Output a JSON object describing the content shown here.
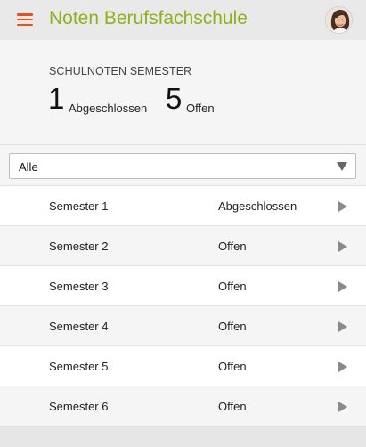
{
  "header": {
    "title": "Noten Berufsfachschule",
    "menu_icon": "hamburger-menu-icon",
    "avatar_icon": "user-avatar",
    "accent_color": "#8fb21a",
    "menu_color": "#e8501f"
  },
  "summary": {
    "title": "SCHULNOTEN SEMESTER",
    "closed_count": "1",
    "closed_label": "Abgeschlossen",
    "open_count": "5",
    "open_label": "Offen"
  },
  "filter": {
    "selected": "Alle",
    "arrow_icon": "caret-down-icon"
  },
  "semesters": [
    {
      "name": "Semester 1",
      "status": "Abgeschlossen"
    },
    {
      "name": "Semester 2",
      "status": "Offen"
    },
    {
      "name": "Semester 3",
      "status": "Offen"
    },
    {
      "name": "Semester 4",
      "status": "Offen"
    },
    {
      "name": "Semester 5",
      "status": "Offen"
    },
    {
      "name": "Semester 6",
      "status": "Offen"
    }
  ]
}
